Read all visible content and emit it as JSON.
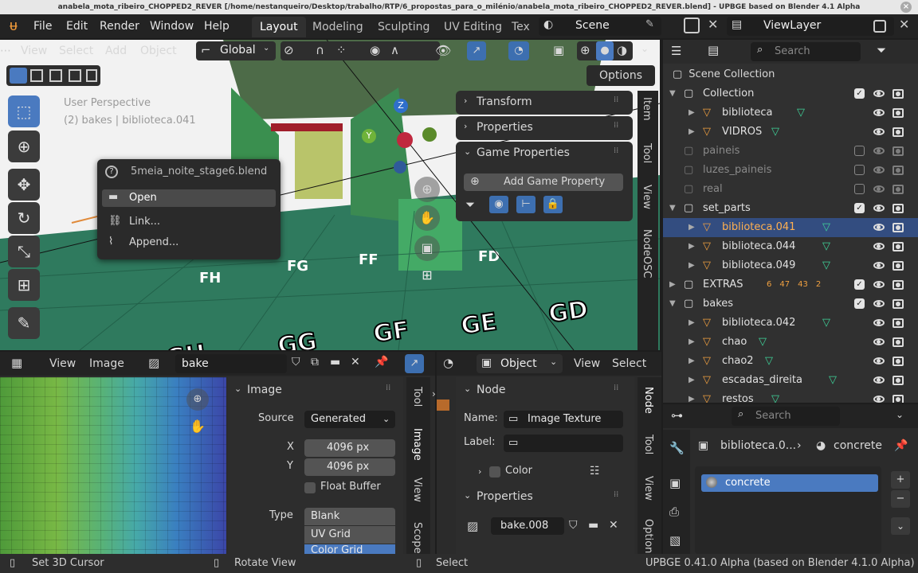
{
  "title_bar": "anabela_mota_ribeiro_CHOPPED2_REVER [/home/nestanqueiro/Desktop/trabalho/RTP/6_propostas_para_o_milénio/anabela_mota_ribeiro_CHOPPED2_REVER.blend] - UPBGE based on Blender 4.1 Alpha",
  "menu": [
    "File",
    "Edit",
    "Render",
    "Window",
    "Help"
  ],
  "workspaces": [
    "Layout",
    "Modeling",
    "Sculpting",
    "UV Editing",
    "Tex"
  ],
  "scene_name": "Scene",
  "viewlayer_name": "ViewLayer",
  "viewport": {
    "menus": [
      "View",
      "Select",
      "Add",
      "Object"
    ],
    "orientation": "Global",
    "options_label": "Options",
    "overlay_line1": "User Perspective",
    "overlay_line2": "(2) bakes | biblioteca.041",
    "axes": {
      "z": "Z",
      "y": "Y"
    },
    "side_tabs": [
      "Item",
      "Tool",
      "View",
      "NodeOSC"
    ]
  },
  "file_popup": {
    "filename": "5meia_noite_stage6.blend",
    "items": [
      "Open",
      "Link...",
      "Append..."
    ]
  },
  "n_panel": {
    "sections": [
      "Transform",
      "Properties",
      "Game Properties"
    ],
    "add_button": "Add Game Property"
  },
  "outliner": {
    "search_placeholder": "Search",
    "root": "Scene Collection",
    "rows": [
      {
        "label": "Collection",
        "level": 0,
        "expand": "v",
        "type": "coll",
        "check": true
      },
      {
        "label": "biblioteca",
        "level": 1,
        "expand": ">",
        "type": "obj",
        "check": null
      },
      {
        "label": "VIDROS",
        "level": 1,
        "expand": ">",
        "type": "obj",
        "check": null
      },
      {
        "label": "paineis",
        "level": 0,
        "expand": "",
        "type": "coll-dim",
        "check": false
      },
      {
        "label": "luzes_paineis",
        "level": 0,
        "expand": "",
        "type": "coll-dim",
        "check": false
      },
      {
        "label": "real",
        "level": 0,
        "expand": "",
        "type": "coll-dim",
        "check": false
      },
      {
        "label": "set_parts",
        "level": 0,
        "expand": "v",
        "type": "coll",
        "check": true
      },
      {
        "label": "biblioteca.041",
        "level": 1,
        "expand": ">",
        "type": "obj-sel",
        "check": null
      },
      {
        "label": "biblioteca.044",
        "level": 1,
        "expand": ">",
        "type": "obj",
        "check": null
      },
      {
        "label": "biblioteca.049",
        "level": 1,
        "expand": ">",
        "type": "obj",
        "check": null
      },
      {
        "label": "EXTRAS",
        "level": 0,
        "expand": ">",
        "type": "coll",
        "check": true
      },
      {
        "label": "bakes",
        "level": 0,
        "expand": "v",
        "type": "coll",
        "check": true
      },
      {
        "label": "biblioteca.042",
        "level": 1,
        "expand": ">",
        "type": "obj",
        "check": null
      },
      {
        "label": "chao",
        "level": 1,
        "expand": ">",
        "type": "obj",
        "check": null
      },
      {
        "label": "chao2",
        "level": 1,
        "expand": ">",
        "type": "obj",
        "check": null
      },
      {
        "label": "escadas_direita",
        "level": 1,
        "expand": ">",
        "type": "obj",
        "check": null
      },
      {
        "label": "restos",
        "level": 1,
        "expand": ">",
        "type": "obj",
        "check": null
      }
    ],
    "extras_counts": [
      "6",
      "47",
      "43",
      "2"
    ]
  },
  "properties": {
    "search_placeholder": "Search",
    "breadcrumb_object": "biblioteca.0...",
    "breadcrumb_material": "concrete",
    "material_slot": "concrete"
  },
  "image_editor": {
    "menus": [
      "View",
      "Image"
    ],
    "image_name": "bake",
    "panel_title": "Image",
    "source_label": "Source",
    "source_value": "Generated",
    "x_label": "X",
    "x_value": "4096 px",
    "y_label": "Y",
    "y_value": "4096 px",
    "float_buffer": "Float Buffer",
    "type_label": "Type",
    "type_options": [
      "Blank",
      "UV Grid",
      "Color Grid"
    ],
    "side_tabs": [
      "Tool",
      "Image",
      "View",
      "Scope"
    ]
  },
  "node_editor": {
    "mode": "Object",
    "menus": [
      "View",
      "Select"
    ],
    "node_panel": "Node",
    "name_label": "Name:",
    "name_value": "Image Texture",
    "label_label": "Label:",
    "label_value": "",
    "color_label": "Color",
    "properties_label": "Properties",
    "image_value": "bake.008",
    "side_tabs": [
      "Node",
      "Tool",
      "View",
      "Option"
    ]
  },
  "status_bar": {
    "left": "Set 3D Cursor",
    "middle": "Rotate View",
    "right_hint": "Select",
    "version": "UPBGE 0.41.0 Alpha (based on Blender 4.1.0 Alpha)"
  }
}
